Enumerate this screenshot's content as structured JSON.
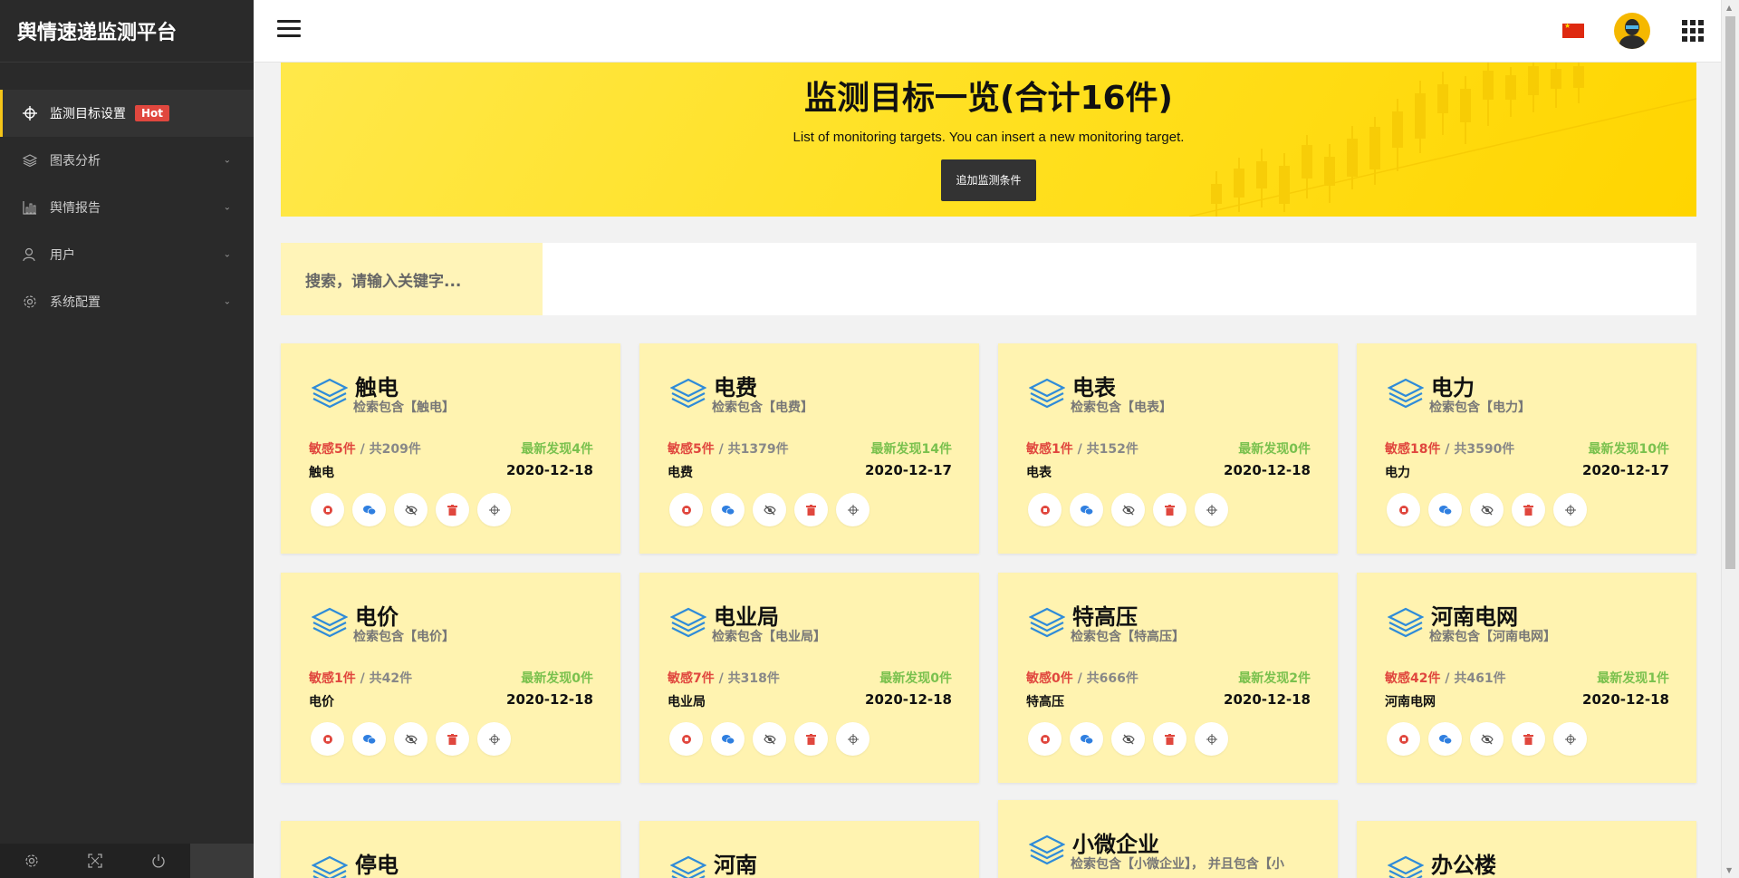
{
  "app": {
    "title": "舆情速递监测平台"
  },
  "sidebar": {
    "items": [
      {
        "label": "监测目标设置",
        "badge": "Hot",
        "icon": "crosshair-icon"
      },
      {
        "label": "图表分析",
        "icon": "layers-icon"
      },
      {
        "label": "舆情报告",
        "icon": "bar-chart-icon"
      },
      {
        "label": "用户",
        "icon": "user-icon"
      },
      {
        "label": "系统配置",
        "icon": "gear-icon"
      }
    ],
    "footer": [
      "gear-icon",
      "fullscreen-icon",
      "power-icon"
    ]
  },
  "banner": {
    "title": "监测目标一览(合计16件)",
    "subtitle": "List of monitoring targets. You can insert a new monitoring target.",
    "add_button": "追加监测条件"
  },
  "search": {
    "label": "搜索，请输入关键字...",
    "value": ""
  },
  "cards": [
    {
      "title": "触电",
      "keyword": "检索包含【触电】",
      "sensitive": "敏感5件",
      "total": " / 共209件",
      "latest": "最新发现4件",
      "name": "触电",
      "date": "2020-12-18"
    },
    {
      "title": "电费",
      "keyword": "检索包含【电费】",
      "sensitive": "敏感5件",
      "total": " / 共1379件",
      "latest": "最新发现14件",
      "name": "电费",
      "date": "2020-12-17"
    },
    {
      "title": "电表",
      "keyword": "检索包含【电表】",
      "sensitive": "敏感1件",
      "total": " / 共152件",
      "latest": "最新发现0件",
      "name": "电表",
      "date": "2020-12-18"
    },
    {
      "title": "电力",
      "keyword": "检索包含【电力】",
      "sensitive": "敏感18件",
      "total": " / 共3590件",
      "latest": "最新发现10件",
      "name": "电力",
      "date": "2020-12-17"
    },
    {
      "title": "电价",
      "keyword": "检索包含【电价】",
      "sensitive": "敏感1件",
      "total": " / 共42件",
      "latest": "最新发现0件",
      "name": "电价",
      "date": "2020-12-18"
    },
    {
      "title": "电业局",
      "keyword": "检索包含【电业局】",
      "sensitive": "敏感7件",
      "total": " / 共318件",
      "latest": "最新发现0件",
      "name": "电业局",
      "date": "2020-12-18"
    },
    {
      "title": "特高压",
      "keyword": "检索包含【特高压】",
      "sensitive": "敏感0件",
      "total": " / 共666件",
      "latest": "最新发现2件",
      "name": "特高压",
      "date": "2020-12-18"
    },
    {
      "title": "河南电网",
      "keyword": "检索包含【河南电网】",
      "sensitive": "敏感42件",
      "total": " / 共461件",
      "latest": "最新发现1件",
      "name": "河南电网",
      "date": "2020-12-18"
    },
    {
      "title": "停电"
    },
    {
      "title": "河南"
    },
    {
      "title": "小微企业",
      "keyword": "检索包含【小微企业】， 并且包含【小"
    },
    {
      "title": "办公楼"
    }
  ],
  "card_actions": [
    "stop-icon",
    "wechat-icon",
    "hide-icon",
    "trash-icon",
    "crosshair-icon"
  ],
  "colors": {
    "sidebar_bg": "#2a2a2a",
    "banner_yellow": "#ffe020",
    "card_bg": "#fff3b0",
    "danger": "#e0473e",
    "success": "#7ac14e",
    "accent": "#f5c518"
  }
}
